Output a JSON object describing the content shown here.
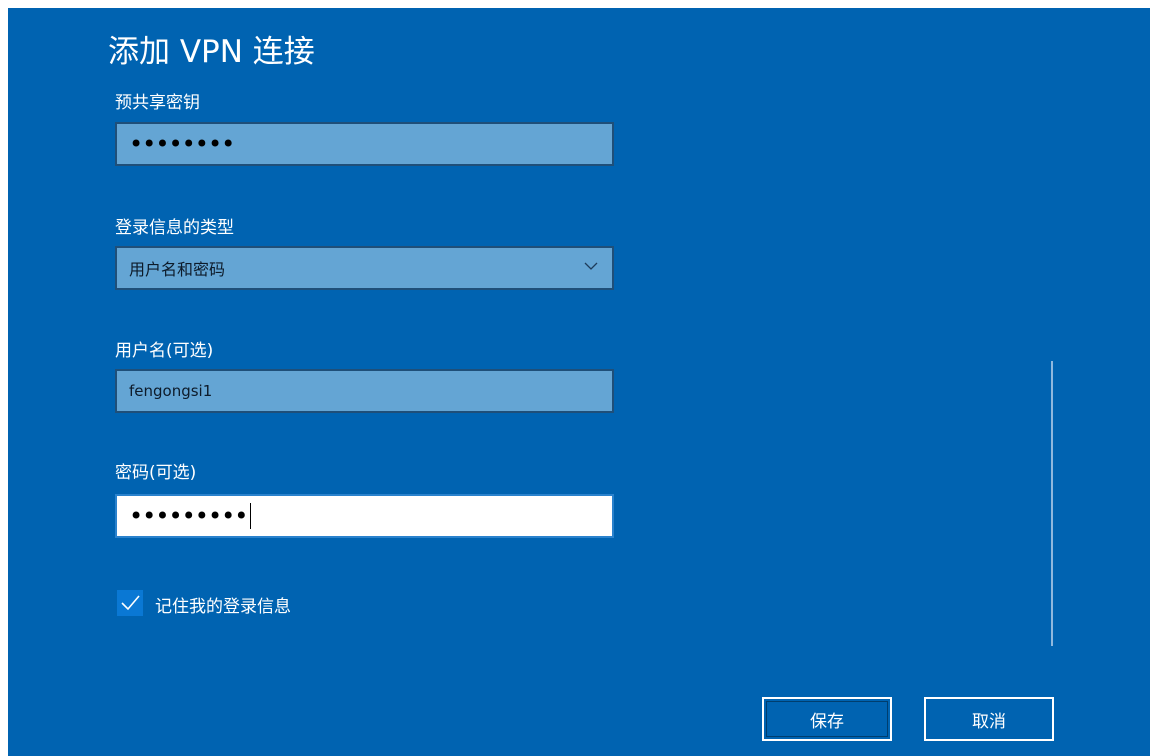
{
  "dialog": {
    "title": "添加 VPN 连接"
  },
  "form": {
    "preshared_key": {
      "label": "预共享密钥",
      "masked_value": "••••••••"
    },
    "signin_type": {
      "label": "登录信息的类型",
      "selected": "用户名和密码",
      "icon": "chevron-down-icon"
    },
    "username": {
      "label": "用户名(可选)",
      "value": "fengongsi1"
    },
    "password": {
      "label": "密码(可选)",
      "masked_value": "•••••••••"
    },
    "remember": {
      "label": "记住我的登录信息",
      "checked": true,
      "icon": "checkmark-icon"
    }
  },
  "buttons": {
    "save": "保存",
    "cancel": "取消"
  },
  "colors": {
    "background": "#0063b1",
    "field_fill": "#64a5d4",
    "field_border": "#1f4f79",
    "active_field": "#ffffff",
    "checkbox": "#0a78d4"
  }
}
